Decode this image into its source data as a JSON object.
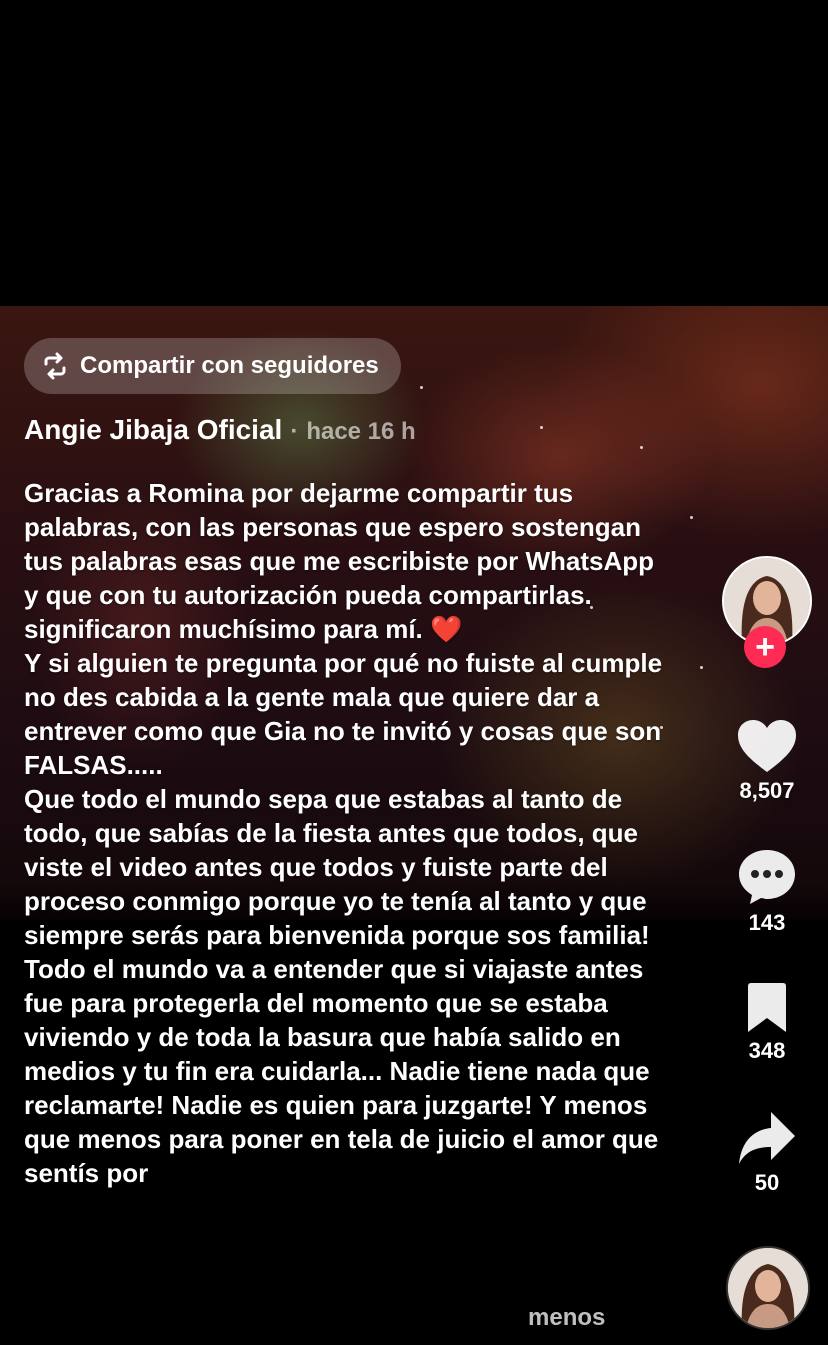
{
  "share": {
    "label": "Compartir con seguidores",
    "icon": "repost-icon"
  },
  "post": {
    "author": "Angie Jibaja Oficial",
    "separator": "·",
    "time": "hace 16 h",
    "caption": "Gracias  a  Romina por dejarme compartir tus palabras, con las personas que espero sostengan tus palabras esas que me escribiste por WhatsApp y que con tu autorización pueda compartirlas. significaron muchísimo para mí. ❤️\nY si alguien te pregunta por qué no fuiste al cumple no des cabida a la gente mala que quiere dar a entrever como que Gia no te invitó y cosas que son FALSAS.....\nQue todo el mundo sepa que estabas al tanto de todo, que sabías de la fiesta antes que todos, que viste el video antes que todos y fuiste parte del proceso conmigo porque yo te tenía al tanto y que siempre serás para   bienvenida porque sos familia! Todo el mundo va a entender que si viajaste antes fue para protegerla del momento que se estaba viviendo y de toda la basura que había salido en medios y tu fin era cuidarla... Nadie tiene nada que reclamarte! Nadie es quien para juzgarte! Y menos que menos para poner en tela de juicio el amor que sentís por",
    "less_label": "menos"
  },
  "actions": {
    "follow_symbol": "+",
    "likes": "8,507",
    "comments": "143",
    "saves": "348",
    "shares": "50"
  },
  "colors": {
    "follow": "#fe2c55",
    "chip_bg": "rgba(255,255,255,0.22)"
  }
}
